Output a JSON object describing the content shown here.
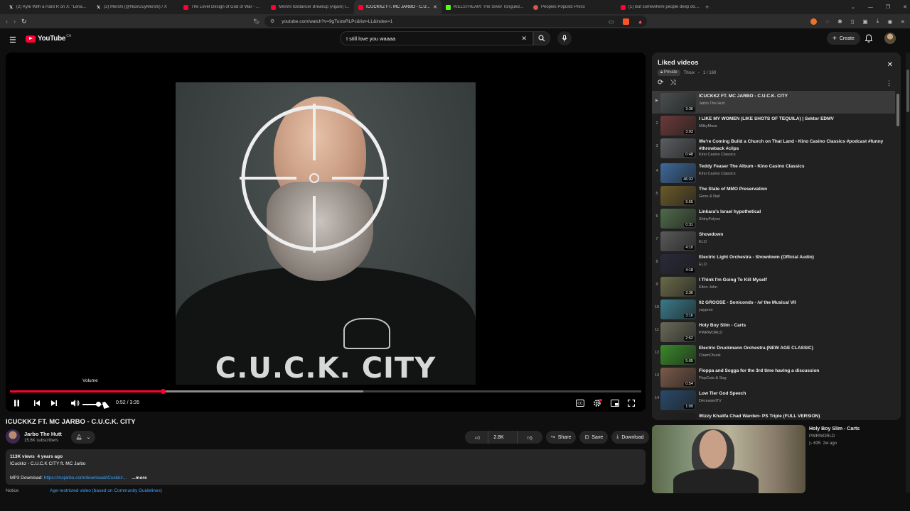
{
  "browser": {
    "tabs": [
      {
        "title": "(2) Kyle With a Hard R on X: \"Lena T...",
        "icon": "x-favicon",
        "active": false
      },
      {
        "title": "(2) Mershi (@NiceGuyMershi) / X",
        "icon": "x-favicon",
        "active": false
      },
      {
        "title": "The Level Design of God of War - Yo...",
        "icon": "youtube-favicon",
        "active": false
      },
      {
        "title": "Mershi Icedancer Breakup (Again) I...",
        "icon": "youtube-favicon",
        "active": false
      },
      {
        "title": "ICUCKKZ FT. MC JARBO - C.U...",
        "icon": "youtube-favicon",
        "active": true
      },
      {
        "title": "KIELSTREAM: The Silver Tongued Dev...",
        "icon": "kick-favicon",
        "active": false
      },
      {
        "title": "Peoples Populist Press",
        "icon": "web-favicon",
        "active": false
      },
      {
        "title": "(1) But somewhere people deep dow...",
        "icon": "youtube-favicon",
        "active": false
      }
    ],
    "url": "youtube.com/watch?v=9gTuizeRLPc&list=LL&index=1"
  },
  "header": {
    "logo": "YouTube",
    "region": "CA",
    "search_value": "I still love you waaaa",
    "search_placeholder": "Search",
    "create_label": "Create"
  },
  "player": {
    "thumbnail_text": "C.U.C.K. CITY",
    "volume_tooltip": "Volume",
    "time_current": "0:52",
    "time_sep": " / ",
    "time_total": "3:35",
    "progress_played": 0.242,
    "progress_buffered": 0.56,
    "volume_level": 0.72
  },
  "video": {
    "title": "ICUCKKZ FT. MC JARBO - C.U.C.K. CITY",
    "channel": "Jarbo The Hutt",
    "subscribers": "15.6K subscribers",
    "likes": "2.8K",
    "share_label": "Share",
    "save_label": "Save",
    "download_label": "Download",
    "views": "113K views",
    "age": "4 years ago",
    "desc_line1": "ICuckkz - C.U.C.K CITY ft. MC Jarbo",
    "desc_mp3_label": "MP3 Download: ",
    "desc_mp3_link": "https://mcjarbo.com/download/iCuckkz...",
    "more_label": "...more",
    "notice_label": "Notice",
    "notice_link": "Age-restricted video (based on Community Guidelines)"
  },
  "playlist": {
    "title": "Liked videos",
    "privacy": "Private",
    "owner": "Thrux",
    "position": "1 / 160",
    "items": [
      {
        "index": "▶",
        "title": "ICUCKKZ FT. MC JARBO - C.U.C.K. CITY",
        "channel": "Jarbo The Hutt",
        "duration": "3:36",
        "color": "#4a4f4f"
      },
      {
        "index": "2",
        "title": "I LIKE MY WOMEN (LIKE SHOTS OF TEQUILA) | Sektor EDMV",
        "channel": "MilkyMuse",
        "duration": "3:03",
        "color": "#6b3a3a"
      },
      {
        "index": "3",
        "title": "We're Coming Build a Church on That Land - Kino Casino Classics #podcast #funny #throwback #clips",
        "channel": "Kino Casino Classics",
        "duration": "0:48",
        "color": "#5b5e62"
      },
      {
        "index": "4",
        "title": "Teddy Feaser The Album - Kino Casino Classics",
        "channel": "Kino Casino Classics",
        "duration": "46:32",
        "color": "#3e6a9a"
      },
      {
        "index": "5",
        "title": "The State of MMO Preservation",
        "channel": "Geno & Nail",
        "duration": "9:55",
        "color": "#6a5a2a"
      },
      {
        "index": "6",
        "title": "Linkara's Israel hypothetical",
        "channel": "ShinyFelyne",
        "duration": "0:31",
        "color": "#4f6a4a"
      },
      {
        "index": "7",
        "title": "Showdown",
        "channel": "ELO",
        "duration": "4:10",
        "color": "#5a5a5a"
      },
      {
        "index": "8",
        "title": "Electric Light Orchestra - Showdown (Official Audio)",
        "channel": "ELO",
        "duration": "4:18",
        "color": "#2a2a3a"
      },
      {
        "index": "9",
        "title": "I Think I'm Going To Kill Myself",
        "channel": "Elton John",
        "duration": "3:36",
        "color": "#6a6a4a"
      },
      {
        "index": "10",
        "title": "02 GROOSE - Soniconds - /v/ the Musical VII",
        "channel": "yayproo",
        "duration": "3:16",
        "color": "#3a7a8a"
      },
      {
        "index": "11",
        "title": "Holy Boy Slim - Carts",
        "channel": "PWRWORLD",
        "duration": "2:52",
        "color": "#6a6a5a"
      },
      {
        "index": "12",
        "title": "Electric Druckmann Orchestra (NEW AGE CLASSIC)",
        "channel": "ChamChunk",
        "duration": "5:05",
        "color": "#3a8a2a"
      },
      {
        "index": "13",
        "title": "Floppa and Sogga for the 3rd time having a discussion",
        "channel": "FlopCuts & Sog",
        "duration": "0:54",
        "color": "#7a5a4a"
      },
      {
        "index": "14",
        "title": "Low Tier God Speech",
        "channel": "DeceasedTV",
        "duration": "1:09",
        "color": "#2a4a6a"
      },
      {
        "index": "",
        "title": "Wizzy Khalifa Chad Warden- PS Triple (FULL VERSION)",
        "channel": "",
        "duration": "",
        "color": "#212121"
      }
    ]
  },
  "recommended": {
    "title": "Holy Boy Slim - Carts",
    "channel": "PWRWORLD",
    "views": "635",
    "age": "2w ago"
  },
  "colors": {
    "accent": "#ff0033",
    "link": "#3ea6ff",
    "bg": "#0f0f0f"
  }
}
